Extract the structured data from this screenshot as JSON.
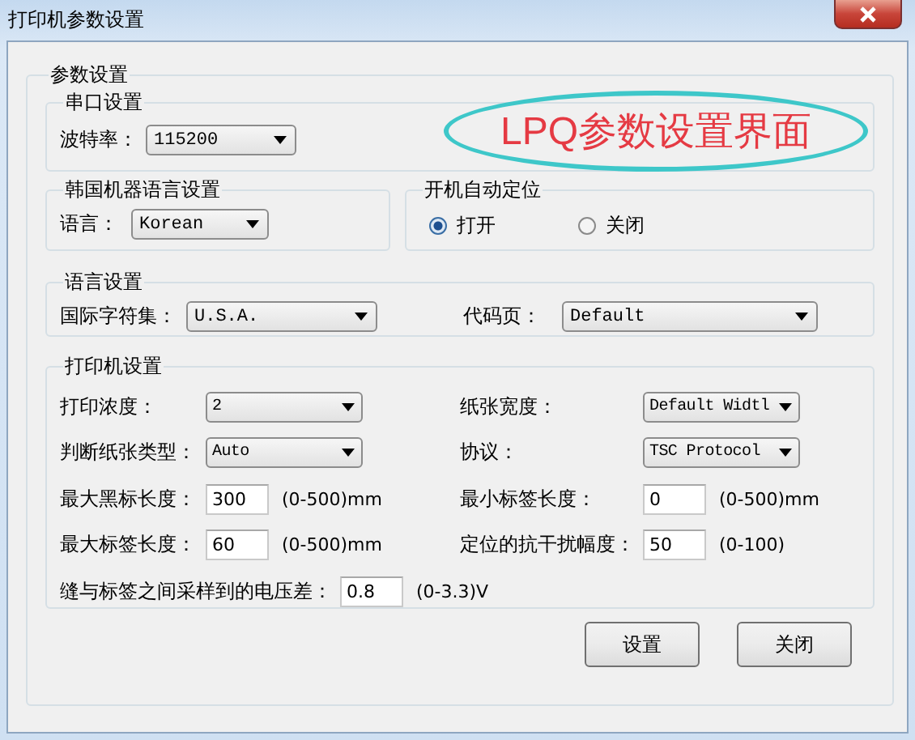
{
  "window": {
    "title": "打印机参数设置"
  },
  "annotation": {
    "text": "LPQ参数设置界面"
  },
  "parameter_group": {
    "title": "参数设置"
  },
  "serial_port": {
    "title": "串口设置",
    "label": "波特率：",
    "value": "115200"
  },
  "korean_language": {
    "title": "韩国机器语言设置",
    "label": "语言：",
    "value": "Korean"
  },
  "auto_positioning": {
    "title": "开机自动定位",
    "options": [
      {
        "label": "打开",
        "selected": true
      },
      {
        "label": "关闭",
        "selected": false
      }
    ]
  },
  "language_settings": {
    "title": "语言设置",
    "fields": [
      {
        "label": "国际字符集：",
        "value": "U.S.A."
      },
      {
        "label": "代码页：",
        "value": "Default"
      }
    ]
  },
  "printer_settings": {
    "title": "打印机设置",
    "rows": [
      {
        "fields": [
          {
            "kind": "dropdown",
            "label": "打印浓度：",
            "value": "2"
          },
          {
            "kind": "dropdown",
            "label": "纸张宽度：",
            "value": "Default Widtl"
          }
        ]
      },
      {
        "fields": [
          {
            "kind": "dropdown",
            "label": "判断纸张类型：",
            "value": "Auto"
          },
          {
            "kind": "dropdown",
            "label": "协议：",
            "value": "TSC Protocol"
          }
        ]
      },
      {
        "fields": [
          {
            "kind": "text",
            "label": "最大黑标长度：",
            "value": "300",
            "unit": "(0-500)mm"
          },
          {
            "kind": "text",
            "label": "最小标签长度：",
            "value": "0",
            "unit": "(0-500)mm"
          }
        ]
      },
      {
        "fields": [
          {
            "kind": "text",
            "label": "最大标签长度：",
            "value": "60",
            "unit": "(0-500)mm"
          },
          {
            "kind": "text",
            "label": "定位的抗干扰幅度：",
            "value": "50",
            "unit": "(0-100)"
          }
        ]
      },
      {
        "fields": [
          {
            "kind": "text",
            "label": "缝与标签之间采样到的电压差：",
            "value": "0.8",
            "unit": "(0-3.3)V"
          }
        ]
      }
    ]
  },
  "buttons": [
    "设置",
    "关闭"
  ]
}
